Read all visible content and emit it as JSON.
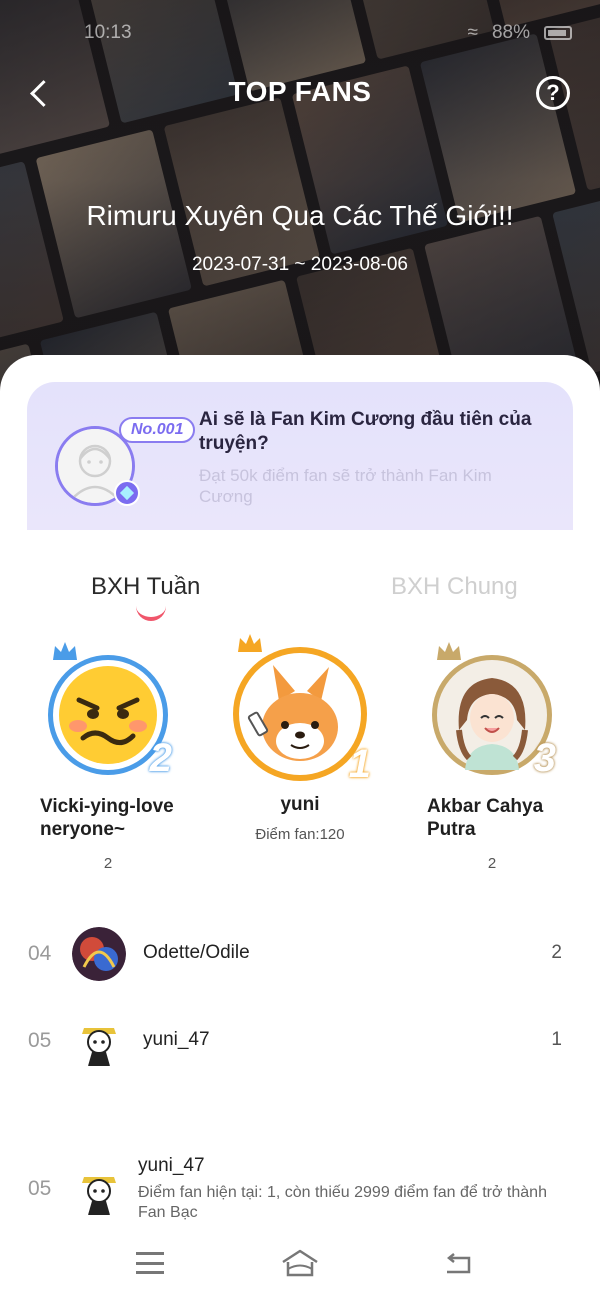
{
  "status_bar": {
    "time": "10:13",
    "battery": "88%"
  },
  "header": {
    "title": "TOP FANS",
    "help_label": "?",
    "comic_title": "Rimuru Xuyên Qua Các Thế Giới!!",
    "date_range": "2023-07-31 ~ 2023-08-06"
  },
  "diamond_card": {
    "badge": "No.001",
    "heading": "Ai sẽ là Fan Kim Cương đầu tiên của truyện?",
    "subtext": "Đạt 50k điểm fan sẽ trở thành Fan Kim Cương"
  },
  "tabs": [
    {
      "label": "BXH Tuần",
      "active": true
    },
    {
      "label": "BXH Chung",
      "active": false
    }
  ],
  "podium": {
    "first": {
      "rank": "1",
      "name": "yuni",
      "score_label": "Điểm fan:120"
    },
    "second": {
      "rank": "2",
      "name": "Vicki-ying-love neryone~",
      "score": "2"
    },
    "third": {
      "rank": "3",
      "name": "Akbar Cahya Putra",
      "score": "2"
    }
  },
  "list": [
    {
      "rank": "04",
      "name": "Odette/Odile",
      "score": "2"
    },
    {
      "rank": "05",
      "name": "yuni_47",
      "score": "1"
    }
  ],
  "my_rank": {
    "rank": "05",
    "name": "yuni_47",
    "description": "Điểm fan hiện tại: 1, còn thiếu 2999 điểm fan để trở thành Fan Bạc"
  },
  "colors": {
    "accent_pink": "#f0566b",
    "diamond_purple": "#8a7cf0",
    "rank1_ring": "#f5a623",
    "rank2_ring": "#4a9ce8",
    "rank3_ring": "#c8a96a"
  },
  "icons": {
    "back": "chevron-left-icon",
    "help": "question-circle-icon",
    "gem": "diamond-icon",
    "nav_menu": "menu-icon",
    "nav_home": "home-icon",
    "nav_back": "return-icon"
  }
}
